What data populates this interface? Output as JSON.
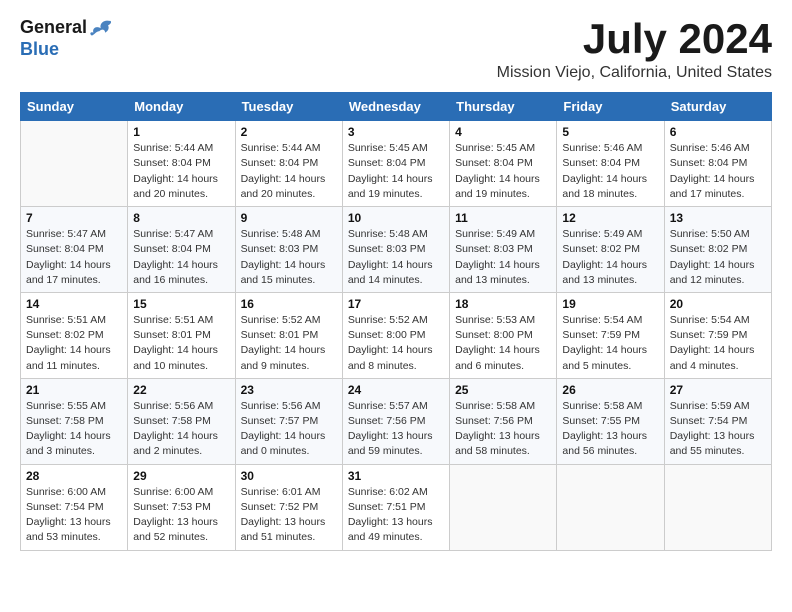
{
  "logo": {
    "general": "General",
    "blue": "Blue"
  },
  "header": {
    "month": "July 2024",
    "location": "Mission Viejo, California, United States"
  },
  "days_of_week": [
    "Sunday",
    "Monday",
    "Tuesday",
    "Wednesday",
    "Thursday",
    "Friday",
    "Saturday"
  ],
  "weeks": [
    [
      {
        "date": "",
        "info": ""
      },
      {
        "date": "1",
        "info": "Sunrise: 5:44 AM\nSunset: 8:04 PM\nDaylight: 14 hours\nand 20 minutes."
      },
      {
        "date": "2",
        "info": "Sunrise: 5:44 AM\nSunset: 8:04 PM\nDaylight: 14 hours\nand 20 minutes."
      },
      {
        "date": "3",
        "info": "Sunrise: 5:45 AM\nSunset: 8:04 PM\nDaylight: 14 hours\nand 19 minutes."
      },
      {
        "date": "4",
        "info": "Sunrise: 5:45 AM\nSunset: 8:04 PM\nDaylight: 14 hours\nand 19 minutes."
      },
      {
        "date": "5",
        "info": "Sunrise: 5:46 AM\nSunset: 8:04 PM\nDaylight: 14 hours\nand 18 minutes."
      },
      {
        "date": "6",
        "info": "Sunrise: 5:46 AM\nSunset: 8:04 PM\nDaylight: 14 hours\nand 17 minutes."
      }
    ],
    [
      {
        "date": "7",
        "info": "Sunrise: 5:47 AM\nSunset: 8:04 PM\nDaylight: 14 hours\nand 17 minutes."
      },
      {
        "date": "8",
        "info": "Sunrise: 5:47 AM\nSunset: 8:04 PM\nDaylight: 14 hours\nand 16 minutes."
      },
      {
        "date": "9",
        "info": "Sunrise: 5:48 AM\nSunset: 8:03 PM\nDaylight: 14 hours\nand 15 minutes."
      },
      {
        "date": "10",
        "info": "Sunrise: 5:48 AM\nSunset: 8:03 PM\nDaylight: 14 hours\nand 14 minutes."
      },
      {
        "date": "11",
        "info": "Sunrise: 5:49 AM\nSunset: 8:03 PM\nDaylight: 14 hours\nand 13 minutes."
      },
      {
        "date": "12",
        "info": "Sunrise: 5:49 AM\nSunset: 8:02 PM\nDaylight: 14 hours\nand 13 minutes."
      },
      {
        "date": "13",
        "info": "Sunrise: 5:50 AM\nSunset: 8:02 PM\nDaylight: 14 hours\nand 12 minutes."
      }
    ],
    [
      {
        "date": "14",
        "info": "Sunrise: 5:51 AM\nSunset: 8:02 PM\nDaylight: 14 hours\nand 11 minutes."
      },
      {
        "date": "15",
        "info": "Sunrise: 5:51 AM\nSunset: 8:01 PM\nDaylight: 14 hours\nand 10 minutes."
      },
      {
        "date": "16",
        "info": "Sunrise: 5:52 AM\nSunset: 8:01 PM\nDaylight: 14 hours\nand 9 minutes."
      },
      {
        "date": "17",
        "info": "Sunrise: 5:52 AM\nSunset: 8:00 PM\nDaylight: 14 hours\nand 8 minutes."
      },
      {
        "date": "18",
        "info": "Sunrise: 5:53 AM\nSunset: 8:00 PM\nDaylight: 14 hours\nand 6 minutes."
      },
      {
        "date": "19",
        "info": "Sunrise: 5:54 AM\nSunset: 7:59 PM\nDaylight: 14 hours\nand 5 minutes."
      },
      {
        "date": "20",
        "info": "Sunrise: 5:54 AM\nSunset: 7:59 PM\nDaylight: 14 hours\nand 4 minutes."
      }
    ],
    [
      {
        "date": "21",
        "info": "Sunrise: 5:55 AM\nSunset: 7:58 PM\nDaylight: 14 hours\nand 3 minutes."
      },
      {
        "date": "22",
        "info": "Sunrise: 5:56 AM\nSunset: 7:58 PM\nDaylight: 14 hours\nand 2 minutes."
      },
      {
        "date": "23",
        "info": "Sunrise: 5:56 AM\nSunset: 7:57 PM\nDaylight: 14 hours\nand 0 minutes."
      },
      {
        "date": "24",
        "info": "Sunrise: 5:57 AM\nSunset: 7:56 PM\nDaylight: 13 hours\nand 59 minutes."
      },
      {
        "date": "25",
        "info": "Sunrise: 5:58 AM\nSunset: 7:56 PM\nDaylight: 13 hours\nand 58 minutes."
      },
      {
        "date": "26",
        "info": "Sunrise: 5:58 AM\nSunset: 7:55 PM\nDaylight: 13 hours\nand 56 minutes."
      },
      {
        "date": "27",
        "info": "Sunrise: 5:59 AM\nSunset: 7:54 PM\nDaylight: 13 hours\nand 55 minutes."
      }
    ],
    [
      {
        "date": "28",
        "info": "Sunrise: 6:00 AM\nSunset: 7:54 PM\nDaylight: 13 hours\nand 53 minutes."
      },
      {
        "date": "29",
        "info": "Sunrise: 6:00 AM\nSunset: 7:53 PM\nDaylight: 13 hours\nand 52 minutes."
      },
      {
        "date": "30",
        "info": "Sunrise: 6:01 AM\nSunset: 7:52 PM\nDaylight: 13 hours\nand 51 minutes."
      },
      {
        "date": "31",
        "info": "Sunrise: 6:02 AM\nSunset: 7:51 PM\nDaylight: 13 hours\nand 49 minutes."
      },
      {
        "date": "",
        "info": ""
      },
      {
        "date": "",
        "info": ""
      },
      {
        "date": "",
        "info": ""
      }
    ]
  ]
}
